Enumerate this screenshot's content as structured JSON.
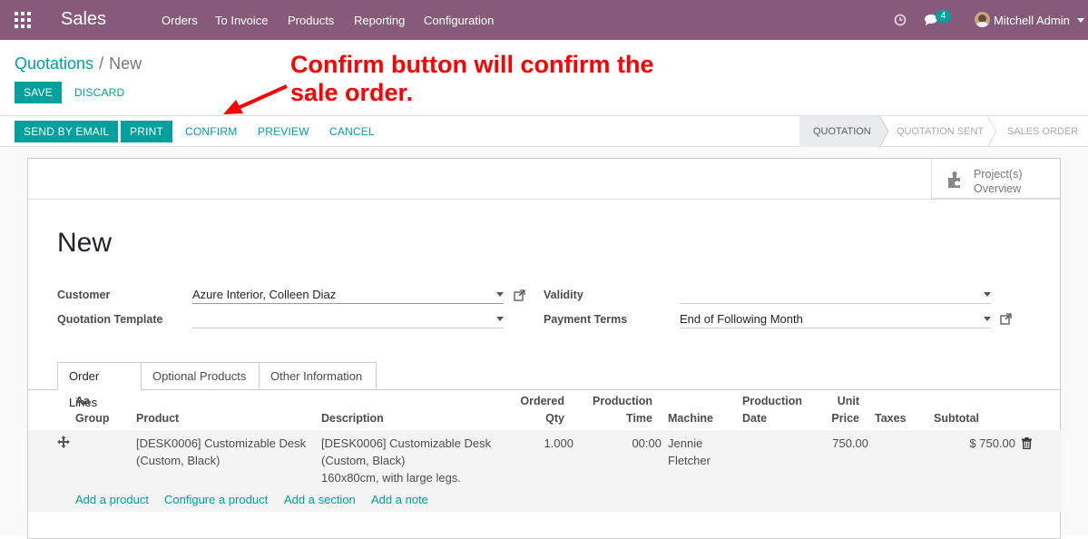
{
  "topbar": {
    "app_name": "Sales",
    "menu": [
      "Orders",
      "To Invoice",
      "Products",
      "Reporting",
      "Configuration"
    ],
    "message_count": "4",
    "user_name": "Mitchell Admin",
    "color": "#875a7b"
  },
  "breadcrumb": {
    "parent": "Quotations",
    "separator": "/",
    "current": "New"
  },
  "buttons": {
    "save": "SAVE",
    "discard": "DISCARD",
    "send_by_email": "SEND BY EMAIL",
    "print": "PRINT",
    "confirm": "CONFIRM",
    "preview": "PREVIEW",
    "cancel": "CANCEL"
  },
  "statusbar": {
    "stages": [
      "QUOTATION",
      "QUOTATION SENT",
      "SALES ORDER"
    ],
    "active": "QUOTATION"
  },
  "annotation": {
    "line1": "Confirm button will confirm the",
    "line2": "sale order."
  },
  "smart_button": {
    "line1": "Project(s)",
    "line2": "Overview",
    "icon": "puzzle-icon"
  },
  "form": {
    "title": "New",
    "customer_label": "Customer",
    "customer_value": "Azure Interior, Colleen Diaz",
    "template_label": "Quotation Template",
    "template_value": "",
    "validity_label": "Validity",
    "validity_value": "",
    "payment_terms_label": "Payment Terms",
    "payment_terms_value": "End of Following Month"
  },
  "tabs": [
    "Order Lines",
    "Optional Products",
    "Other Information"
  ],
  "table": {
    "headers": {
      "group": [
        "Aa",
        "Group"
      ],
      "product": "Product",
      "description": "Description",
      "ordered_qty": [
        "Ordered",
        "Qty"
      ],
      "production_time": [
        "Production",
        "Time"
      ],
      "machine": "Machine",
      "production_date": [
        "Production",
        "Date"
      ],
      "unit_price": [
        "Unit",
        "Price"
      ],
      "taxes": "Taxes",
      "subtotal": "Subtotal"
    },
    "rows": [
      {
        "product": [
          "[DESK0006] Customizable Desk",
          "(Custom, Black)"
        ],
        "description": [
          "[DESK0006] Customizable Desk",
          "(Custom, Black)",
          "160x80cm, with large legs."
        ],
        "ordered_qty": "1.000",
        "production_time": "00:00",
        "machine": [
          "Jennie",
          "Fletcher"
        ],
        "unit_price": "750.00",
        "subtotal": "$ 750.00"
      }
    ],
    "add_links": [
      "Add a product",
      "Configure a product",
      "Add a section",
      "Add a note"
    ]
  }
}
